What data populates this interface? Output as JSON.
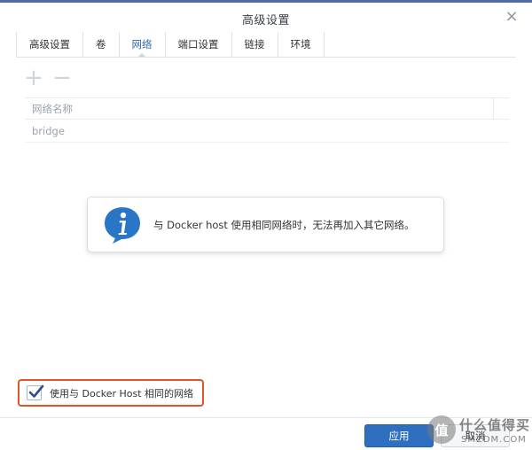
{
  "window": {
    "title": "高级设置",
    "close_symbol": "×"
  },
  "tabs": [
    {
      "label": "高级设置",
      "active": false
    },
    {
      "label": "卷",
      "active": false
    },
    {
      "label": "网络",
      "active": true
    },
    {
      "label": "端口设置",
      "active": false
    },
    {
      "label": "链接",
      "active": false
    },
    {
      "label": "环境",
      "active": false
    }
  ],
  "toolbar": {
    "add_symbol": "+",
    "remove_symbol": "−"
  },
  "table": {
    "header": "网络名称",
    "rows": [
      "bridge"
    ]
  },
  "info": {
    "message": "与 Docker host 使用相同网络时，无法再加入其它网络。"
  },
  "option": {
    "label": "使用与 Docker Host 相同的网络",
    "checked": true,
    "highlight_color": "#e0542a"
  },
  "buttons": {
    "apply": "应用",
    "cancel": "取消"
  },
  "watermark": {
    "badge": "值",
    "text_cn": "什么值得买",
    "text_en": "SMZDM.COM"
  },
  "colors": {
    "accent": "#2f6fc0",
    "title_bar": "#4f6aa6",
    "info_icon": "#2a76c6"
  }
}
